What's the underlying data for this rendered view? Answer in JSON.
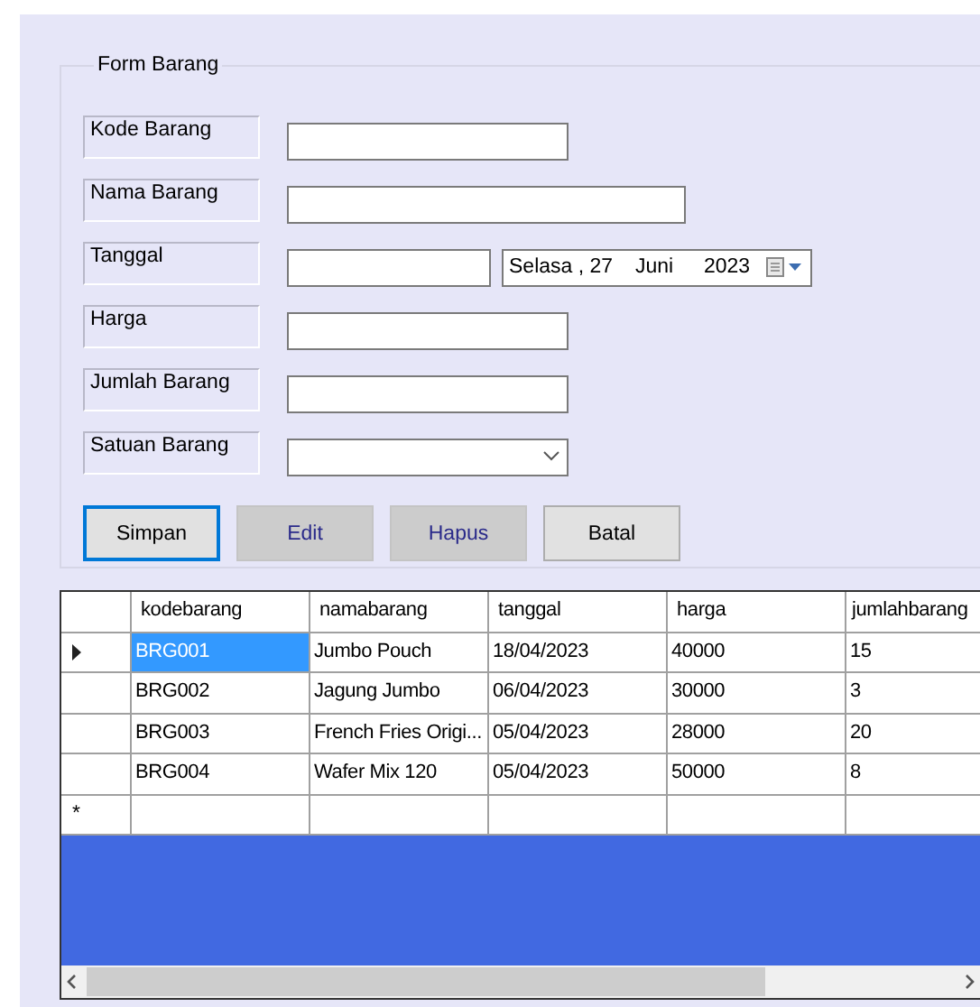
{
  "group": {
    "title": "Form Barang"
  },
  "fields": [
    {
      "label": "Kode Barang",
      "kind": "text"
    },
    {
      "label": "Nama Barang",
      "kind": "text"
    },
    {
      "label": "Tanggal",
      "kind": "date",
      "date": {
        "day": "Selasa , 27",
        "month": "Juni",
        "year": "2023"
      }
    },
    {
      "label": "Harga",
      "kind": "text"
    },
    {
      "label": "Jumlah Barang",
      "kind": "text"
    },
    {
      "label": "Satuan Barang",
      "kind": "combo"
    }
  ],
  "buttons": [
    {
      "label": "Simpan",
      "focused": true,
      "disabled": false
    },
    {
      "label": "Edit",
      "focused": false,
      "disabled": true
    },
    {
      "label": "Hapus",
      "focused": false,
      "disabled": true
    },
    {
      "label": "Batal",
      "focused": false,
      "disabled": false
    }
  ],
  "table": {
    "columns": [
      "kodebarang",
      "namabarang",
      "tanggal",
      "harga",
      "jumlahbarang"
    ],
    "rows": [
      {
        "kind": "data",
        "selected": true,
        "cells": [
          "BRG001",
          "Jumbo Pouch",
          "18/04/2023",
          "40000",
          "15"
        ]
      },
      {
        "kind": "data",
        "selected": false,
        "cells": [
          "BRG002",
          "Jagung Jumbo",
          "06/04/2023",
          "30000",
          "3"
        ]
      },
      {
        "kind": "data",
        "selected": false,
        "cells": [
          "BRG003",
          "French Fries Origi...",
          "05/04/2023",
          "28000",
          "20"
        ]
      },
      {
        "kind": "data",
        "selected": false,
        "cells": [
          "BRG004",
          "Wafer Mix 120",
          "05/04/2023",
          "50000",
          "8"
        ]
      },
      {
        "kind": "new",
        "marker": "*"
      }
    ]
  }
}
